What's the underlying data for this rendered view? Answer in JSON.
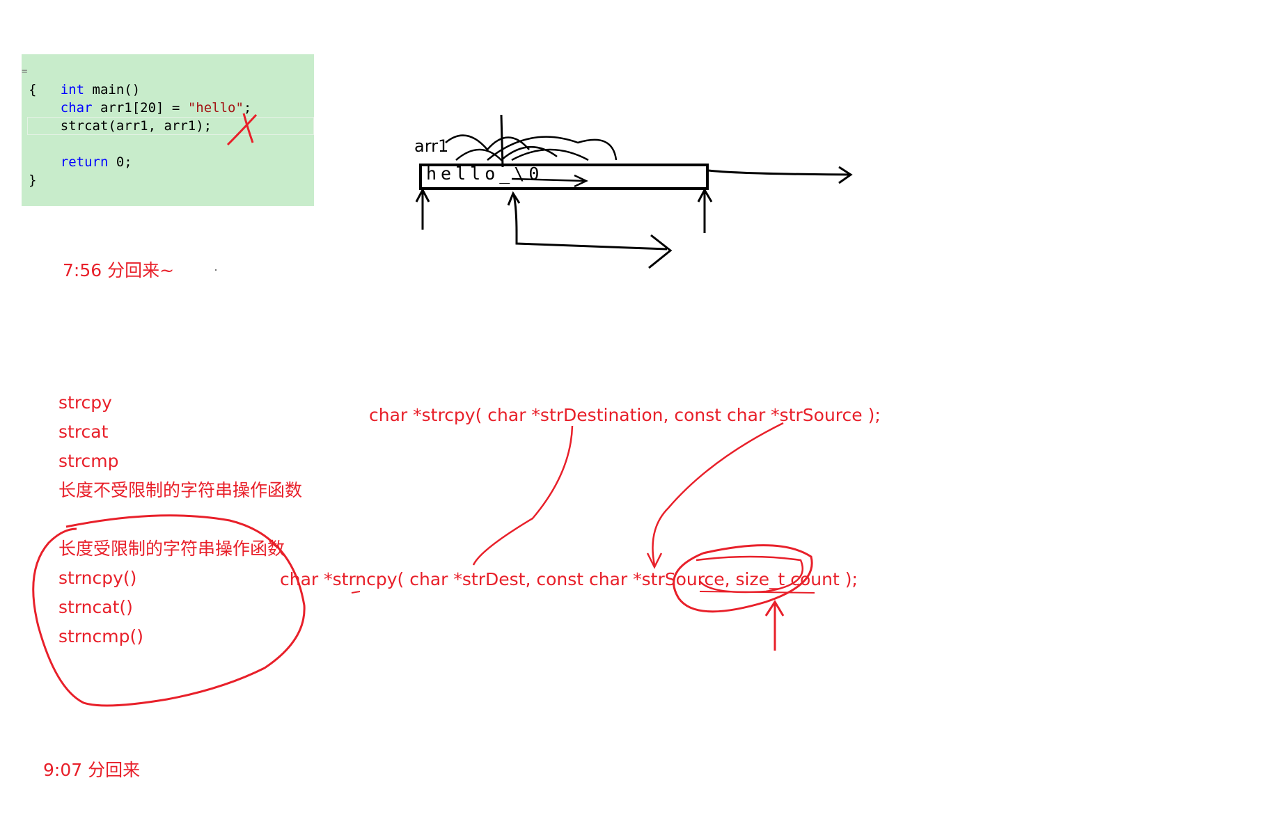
{
  "code": {
    "fold_marker": "=",
    "lines": [
      {
        "kw": "int",
        "rest": " main()"
      },
      {
        "text": "{"
      },
      {
        "indent": "    ",
        "kw": "char",
        "rest": " arr1[20] = ",
        "str": "\"hello\"",
        "tail": ";"
      },
      {
        "indent": "    ",
        "text": "strcat(arr1, arr1);"
      },
      {
        "text": ""
      },
      {
        "indent": "    ",
        "kw": "return",
        "rest": " 0;"
      },
      {
        "text": "}"
      }
    ]
  },
  "diagram": {
    "array_name": "arr1",
    "cells_text": "hello_\\0"
  },
  "notes": {
    "break_1": "7:56 分回来~",
    "unlimited_funcs": [
      "strcpy",
      "strcat",
      "strcmp"
    ],
    "unlimited_title": "长度不受限制的字符串操作函数",
    "limited_title": "长度受限制的字符串操作函数",
    "limited_funcs": [
      "strncpy()",
      "strncat()",
      "strncmp()"
    ],
    "strcpy_proto": "char *strcpy( char *strDestination, const char *strSource );",
    "strncpy_proto": "char *strncpy( char *strDest, const char *strSource, size_t count );",
    "break_2": "9:07 分回来"
  },
  "colors": {
    "code_bg": "#c8eccb",
    "keyword": "#0000ff",
    "string": "#a31515",
    "annotation_red": "#e8202a"
  }
}
